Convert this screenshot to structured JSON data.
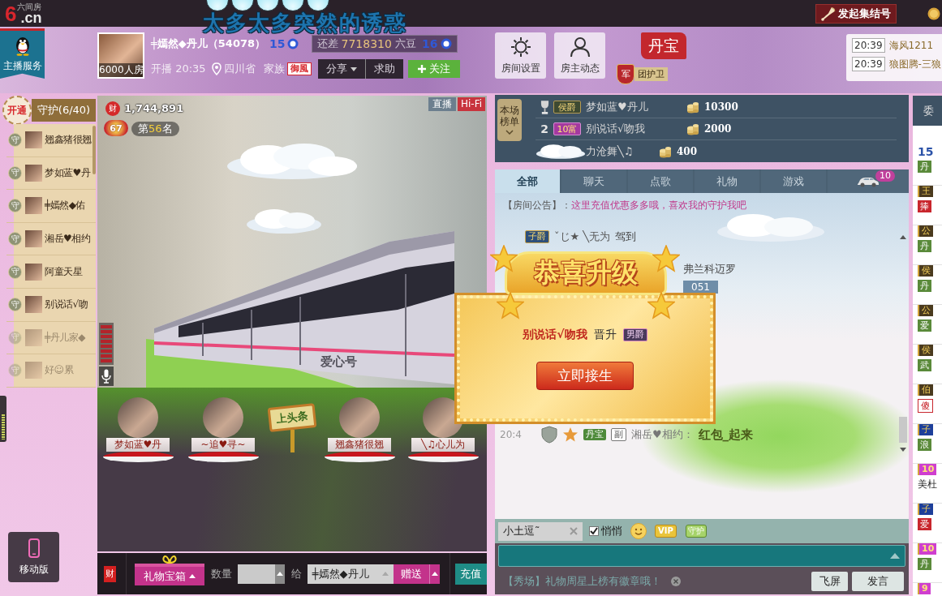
{
  "top_bar": {
    "logo_mark": "6",
    "logo_domain": ".cn",
    "logo_caption": "六间房",
    "rally_button": "发起集结号"
  },
  "flying_message": "太多太多突然的诱惑",
  "header": {
    "service_tab": "主播服务",
    "room_size": "6000人房",
    "host_name": "╪嫣然◆丹儿（54078）",
    "host_level": "15",
    "upgrade_prefix": "还差",
    "upgrade_amount": "7718310",
    "upgrade_unit": "六豆",
    "next_level": "16",
    "start": "开播 20:35",
    "location": "四川省",
    "family_label": "家族",
    "family_badge": "御風",
    "share_button": "分享",
    "help_button": "求助",
    "follow_button": "关注"
  },
  "room_buttons": [
    {
      "kind": "gear",
      "label": "房间设置"
    },
    {
      "kind": "person",
      "label": "房主动态"
    }
  ],
  "flag": "丹宝",
  "guard_tag": {
    "emblem": "军",
    "label": "团护卫"
  },
  "notices": [
    {
      "time": "20:39",
      "text": "海风1211"
    },
    {
      "time": "20:39",
      "text": "狼图腾-三狼"
    }
  ],
  "guards": {
    "open_button": "开通",
    "title": "守护(6/40)",
    "items": [
      {
        "badge": "守",
        "name": "翘鑫猪很翘",
        "online": true
      },
      {
        "badge": "守",
        "name": "梦如蓝♥丹",
        "online": true
      },
      {
        "badge": "守",
        "name": "╪嫣然◆佑",
        "online": true
      },
      {
        "badge": "守",
        "name": "湘岳♥相约",
        "online": true
      },
      {
        "badge": "守",
        "name": "阿童天星",
        "online": true
      },
      {
        "badge": "守",
        "name": "别说话√吻",
        "online": true
      },
      {
        "badge": "守",
        "name": "╪丹儿家◆",
        "online": false
      },
      {
        "badge": "守",
        "name": "好☺累",
        "online": false
      }
    ]
  },
  "side_meter": {
    "level": 0.6
  },
  "mobile_button": "移动版",
  "video": {
    "wealth_icon": "财",
    "wealth": "1,744,891",
    "rank_badge": "67",
    "rank_prefix": "第",
    "rank_value": "56",
    "rank_suffix": "名",
    "live_tag": "直播",
    "quality_tag": "Hi-Fi",
    "mic_meter": {
      "level": 1
    },
    "train_label": "爱心号"
  },
  "seats": [
    {
      "kind": "seat",
      "name": "梦如蓝♥丹"
    },
    {
      "kind": "seat",
      "name": "~追♥寻~"
    },
    {
      "kind": "sign",
      "name": "上头条"
    },
    {
      "kind": "seat",
      "name": "翘鑫猪很翘"
    },
    {
      "kind": "seat",
      "name": "╲♫心儿为"
    }
  ],
  "gift_bar": {
    "wealth_icon": "财",
    "gift_box": "礼物宝箱",
    "quantity_label": "数量",
    "to_label": "给",
    "recipient": "╪嫣然◆丹儿",
    "send_button": "赠送",
    "recharge_button": "充值"
  },
  "ranking": {
    "tag": "本场榜单",
    "rows": [
      {
        "kind": "trophy",
        "badge": {
          "kind": "noble",
          "text": "侯爵"
        },
        "name": "梦如蓝♥丹儿",
        "amount": "10300"
      },
      {
        "kind": "number",
        "rank": "2",
        "badge": {
          "kind": "wealth",
          "text": "10富"
        },
        "name": "别说话√吻我",
        "amount": "2000"
      },
      {
        "kind": "covered",
        "name": "力沧舞╲♫",
        "amount": "400"
      }
    ]
  },
  "tabs": [
    {
      "kind": "text",
      "label": "全部",
      "selected": true
    },
    {
      "kind": "text",
      "label": "聊天",
      "selected": false
    },
    {
      "kind": "text",
      "label": "点歌",
      "selected": false
    },
    {
      "kind": "text",
      "label": "礼物",
      "selected": false
    },
    {
      "kind": "text",
      "label": "游戏",
      "selected": false
    },
    {
      "kind": "car",
      "badge": "10",
      "selected": false
    }
  ],
  "chat": {
    "messages": [
      {
        "kind": "notice",
        "label": "【房间公告】：",
        "text": "这里充值优惠多多哦，喜欢我的守护我吧"
      },
      {
        "kind": "arrival",
        "badge": "子爵",
        "name": "ˇじ★ ╲无为",
        "text": "驾到"
      },
      {
        "kind": "fragment",
        "text": "弗兰科迈罗"
      },
      {
        "kind": "tag",
        "text": "051"
      },
      {
        "kind": "message",
        "time": "20:4",
        "badges": [
          "丹宝",
          "副"
        ],
        "name": "湘岳♥相约：",
        "text": "红包_起来"
      }
    ]
  },
  "popup": {
    "title": "恭喜升级",
    "user": "别说话√吻我",
    "verb": "晋升",
    "badge": "男爵",
    "button": "立即接生"
  },
  "chat_input": {
    "recipient": "小土逗˜",
    "whisper": {
      "label": "悄悄",
      "checked": true
    },
    "vip_icon": "VIP",
    "guard_icon": "守护",
    "notice": "【秀场】礼物周星上榜有徽章哦！",
    "fly_button": "飞屏",
    "send_button": "发言"
  },
  "user_list": {
    "tab": "委",
    "entries": [
      {
        "title": {
          "kind": "number",
          "text": "15"
        },
        "sub": {
          "kind": "family",
          "text": "丹"
        }
      },
      {
        "title": {
          "kind": "noble",
          "text": "王"
        },
        "sub": {
          "kind": "family_red",
          "text": "捧"
        }
      },
      {
        "title": {
          "kind": "noble",
          "text": "公"
        },
        "sub": {
          "kind": "family",
          "text": "丹"
        }
      },
      {
        "title": {
          "kind": "noble",
          "text": "侯"
        },
        "sub": {
          "kind": "family",
          "text": "丹"
        }
      },
      {
        "title": {
          "kind": "noble",
          "text": "公"
        },
        "sub": {
          "kind": "family",
          "text": "爱"
        }
      },
      {
        "title": {
          "kind": "noble",
          "text": "侯"
        },
        "sub": {
          "kind": "family",
          "text": "武"
        }
      },
      {
        "title": {
          "kind": "noble",
          "text": "伯"
        },
        "sub": {
          "kind": "outline",
          "text": "傻"
        }
      },
      {
        "title": {
          "kind": "noble_blue",
          "text": "子"
        },
        "sub": {
          "kind": "family",
          "text": "浪"
        }
      },
      {
        "title": {
          "kind": "level",
          "text": "10"
        },
        "sub": {
          "kind": "name",
          "text": "美杜"
        }
      },
      {
        "title": {
          "kind": "noble_blue",
          "text": "子"
        },
        "sub": {
          "kind": "family_red",
          "text": "爱"
        }
      },
      {
        "title": {
          "kind": "level",
          "text": "10"
        },
        "sub": {
          "kind": "family",
          "text": "丹"
        }
      },
      {
        "title": {
          "kind": "level",
          "text": "9"
        }
      }
    ]
  }
}
